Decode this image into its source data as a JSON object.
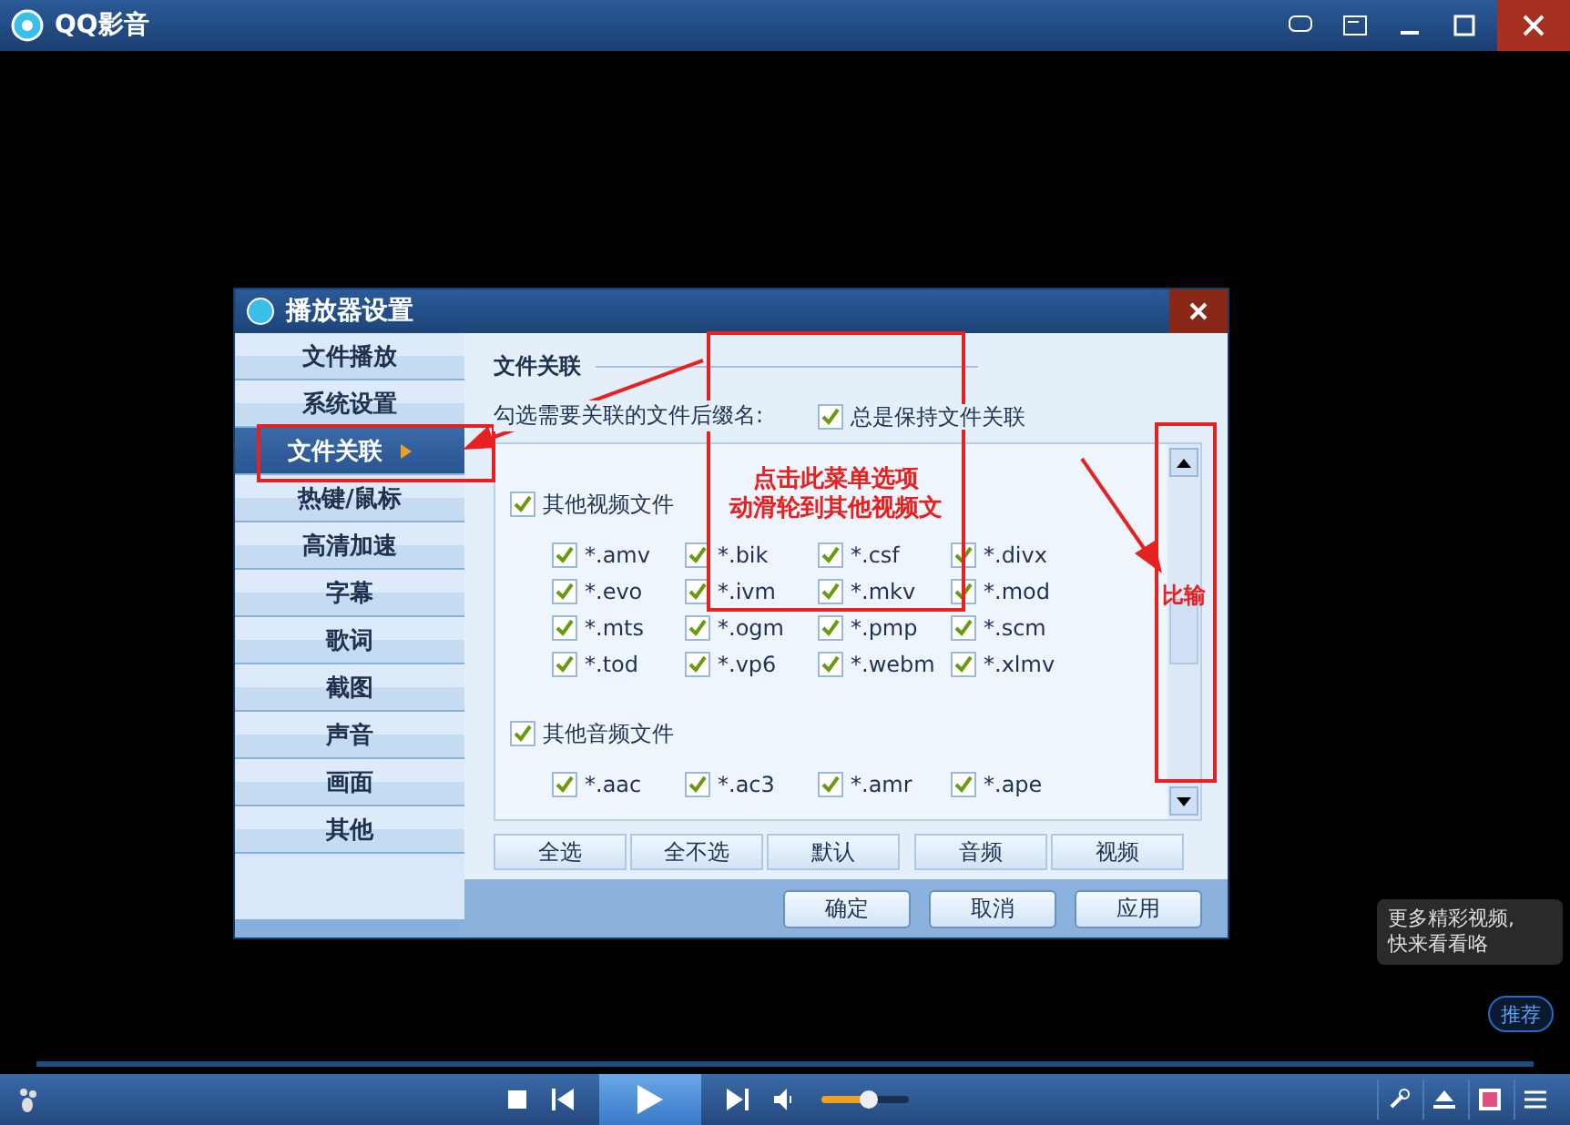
{
  "window": {
    "title": "QQ影音"
  },
  "dialog": {
    "title": "播放器设置",
    "sidebar": [
      {
        "label": "文件播放",
        "selected": false
      },
      {
        "label": "系统设置",
        "selected": false
      },
      {
        "label": "文件关联",
        "selected": true
      },
      {
        "label": "热键/鼠标",
        "selected": false
      },
      {
        "label": "高清加速",
        "selected": false
      },
      {
        "label": "字幕",
        "selected": false
      },
      {
        "label": "歌词",
        "selected": false
      },
      {
        "label": "截图",
        "selected": false
      },
      {
        "label": "声音",
        "selected": false
      },
      {
        "label": "画面",
        "selected": false
      },
      {
        "label": "其他",
        "selected": false
      }
    ],
    "section_title": "文件关联",
    "hint": "勾选需要关联的文件后缀名:",
    "always_keep": {
      "label": "总是保持文件关联",
      "checked": true
    },
    "groups": [
      {
        "label": "其他视频文件",
        "checked": true,
        "items": [
          {
            "label": "*.amv",
            "checked": true
          },
          {
            "label": "*.bik",
            "checked": true
          },
          {
            "label": "*.csf",
            "checked": true
          },
          {
            "label": "*.divx",
            "checked": true
          },
          {
            "label": "*.evo",
            "checked": true
          },
          {
            "label": "*.ivm",
            "checked": true
          },
          {
            "label": "*.mkv",
            "checked": true
          },
          {
            "label": "*.mod",
            "checked": true
          },
          {
            "label": "*.mts",
            "checked": true
          },
          {
            "label": "*.ogm",
            "checked": true
          },
          {
            "label": "*.pmp",
            "checked": true
          },
          {
            "label": "*.scm",
            "checked": true
          },
          {
            "label": "*.tod",
            "checked": true
          },
          {
            "label": "*.vp6",
            "checked": true
          },
          {
            "label": "*.webm",
            "checked": true
          },
          {
            "label": "*.xlmv",
            "checked": true
          }
        ]
      },
      {
        "label": "其他音频文件",
        "checked": true,
        "items": [
          {
            "label": "*.aac",
            "checked": true
          },
          {
            "label": "*.ac3",
            "checked": true
          },
          {
            "label": "*.amr",
            "checked": true
          },
          {
            "label": "*.ape",
            "checked": true
          }
        ]
      }
    ],
    "list_buttons": [
      "全选",
      "全不选",
      "默认",
      "音频",
      "视频"
    ],
    "footer_buttons": [
      "确定",
      "取消",
      "应用"
    ]
  },
  "annotations": {
    "callout_lines": [
      "点击此菜单选项",
      "动滑轮到其他视频文"
    ],
    "side_text": "比输"
  },
  "recommend": {
    "bubble_lines": [
      "更多精彩视频,",
      "快来看看咯"
    ],
    "button": "推荐"
  },
  "player": {
    "volume": {
      "level": 0.55
    }
  }
}
